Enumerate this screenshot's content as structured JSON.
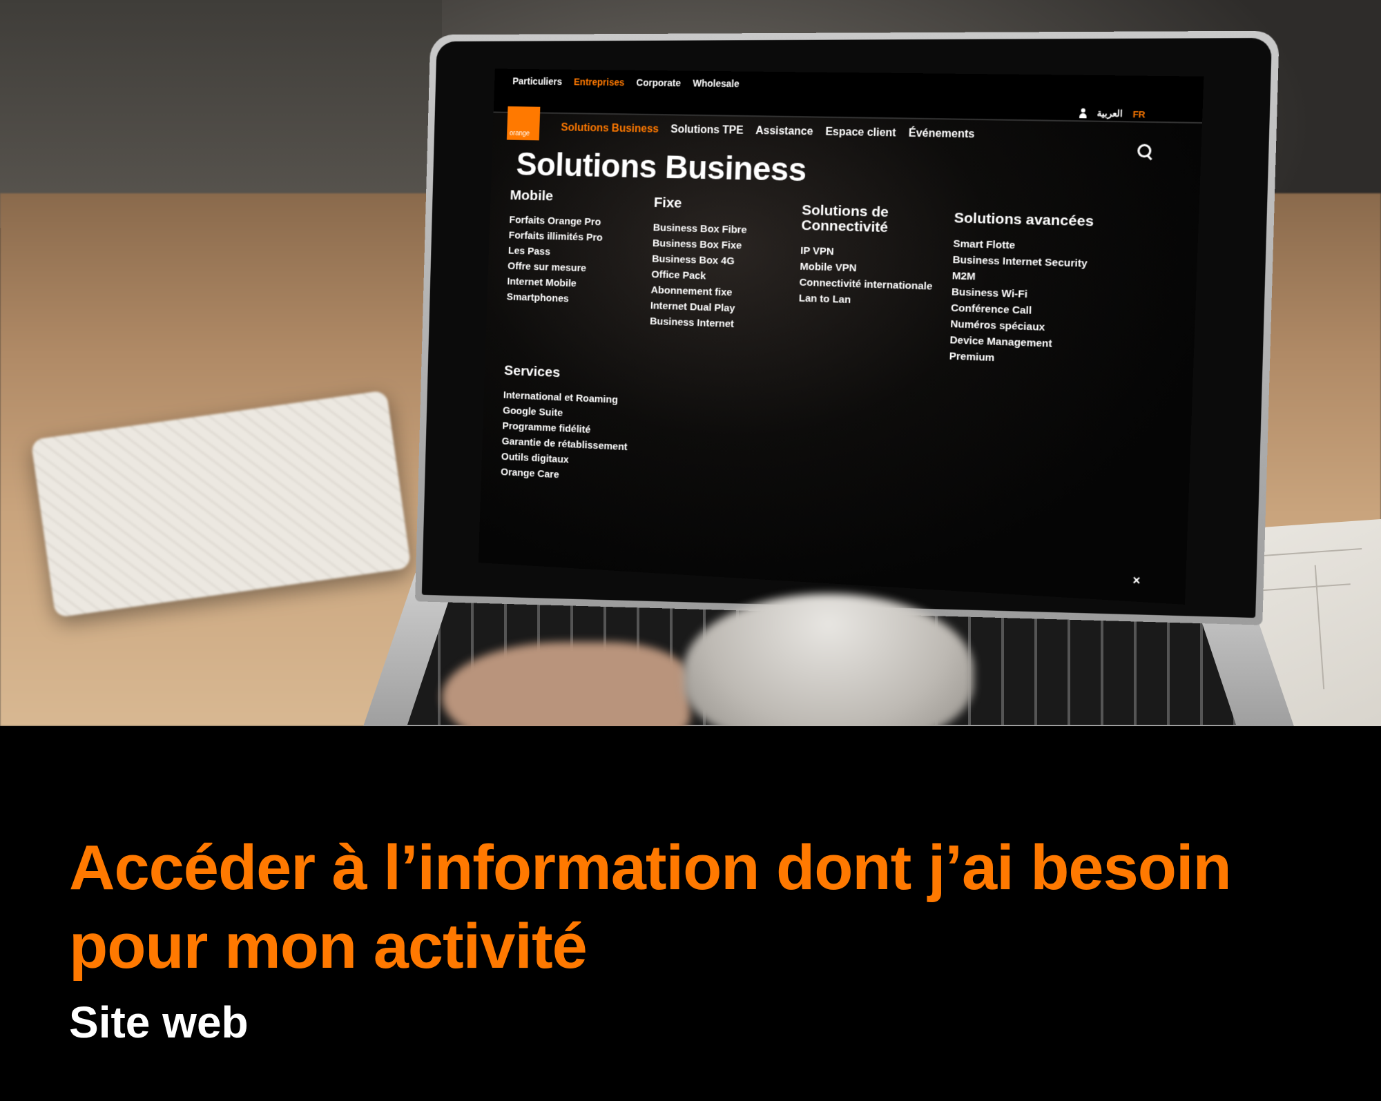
{
  "website": {
    "top_nav": [
      "Particuliers",
      "Entreprises",
      "Corporate",
      "Wholesale"
    ],
    "top_nav_active": "Entreprises",
    "lang": {
      "arabic": "العربية",
      "fr": "FR"
    },
    "logo_text": "orange",
    "main_nav": [
      "Solutions Business",
      "Solutions TPE",
      "Assistance",
      "Espace client",
      "Événements"
    ],
    "main_nav_active": "Solutions Business",
    "page_title": "Solutions Business",
    "columns": {
      "mobile": {
        "title": "Mobile",
        "items": [
          "Forfaits Orange Pro",
          "Forfaits illimités Pro",
          "Les Pass",
          "Offre sur mesure",
          "Internet Mobile",
          "Smartphones"
        ]
      },
      "fixe": {
        "title": "Fixe",
        "items": [
          "Business Box Fibre",
          "Business Box Fixe",
          "Business Box 4G",
          "Office Pack",
          "Abonnement fixe",
          "Internet Dual Play",
          "Business Internet"
        ]
      },
      "connectivite": {
        "title": "Solutions de Connectivité",
        "items": [
          "IP VPN",
          "Mobile VPN",
          "Connectivité internationale",
          "Lan to Lan"
        ]
      },
      "avancees": {
        "title": "Solutions avancées",
        "items": [
          "Smart Flotte",
          "Business Internet Security",
          "M2M",
          "Business Wi-Fi",
          "Conférence Call",
          "Numéros spéciaux",
          "Device Management",
          "Premium"
        ]
      },
      "services": {
        "title": "Services",
        "items": [
          "International et Roaming",
          "Google Suite",
          "Programme fidélité",
          "Garantie de rétablissement",
          "Outils digitaux",
          "Orange Care"
        ]
      }
    },
    "close_glyph": "×"
  },
  "caption": {
    "headline": "Accéder à l’information dont j’ai besoin pour mon activité",
    "subline": "Site web"
  },
  "colors": {
    "brand_orange": "#ff7900",
    "background": "#000000",
    "text": "#ffffff"
  },
  "icons": [
    "user-icon",
    "search-icon",
    "close-icon"
  ]
}
